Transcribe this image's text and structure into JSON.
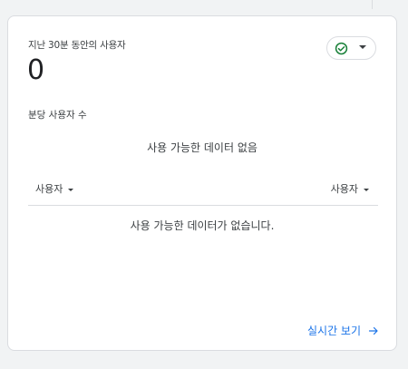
{
  "card": {
    "title": "지난 30분 동안의 사용자",
    "value": "0",
    "status_icon": "check-circle-icon",
    "status_color": "#188038",
    "section_label": "분당 사용자 수",
    "chart_empty_message": "사용 가능한 데이터 없음",
    "table": {
      "columns": [
        "사용자",
        "사용자"
      ],
      "empty_message": "사용 가능한 데이터가 없습니다."
    },
    "link_label": "실시간 보기",
    "link_color": "#1a73e8"
  }
}
